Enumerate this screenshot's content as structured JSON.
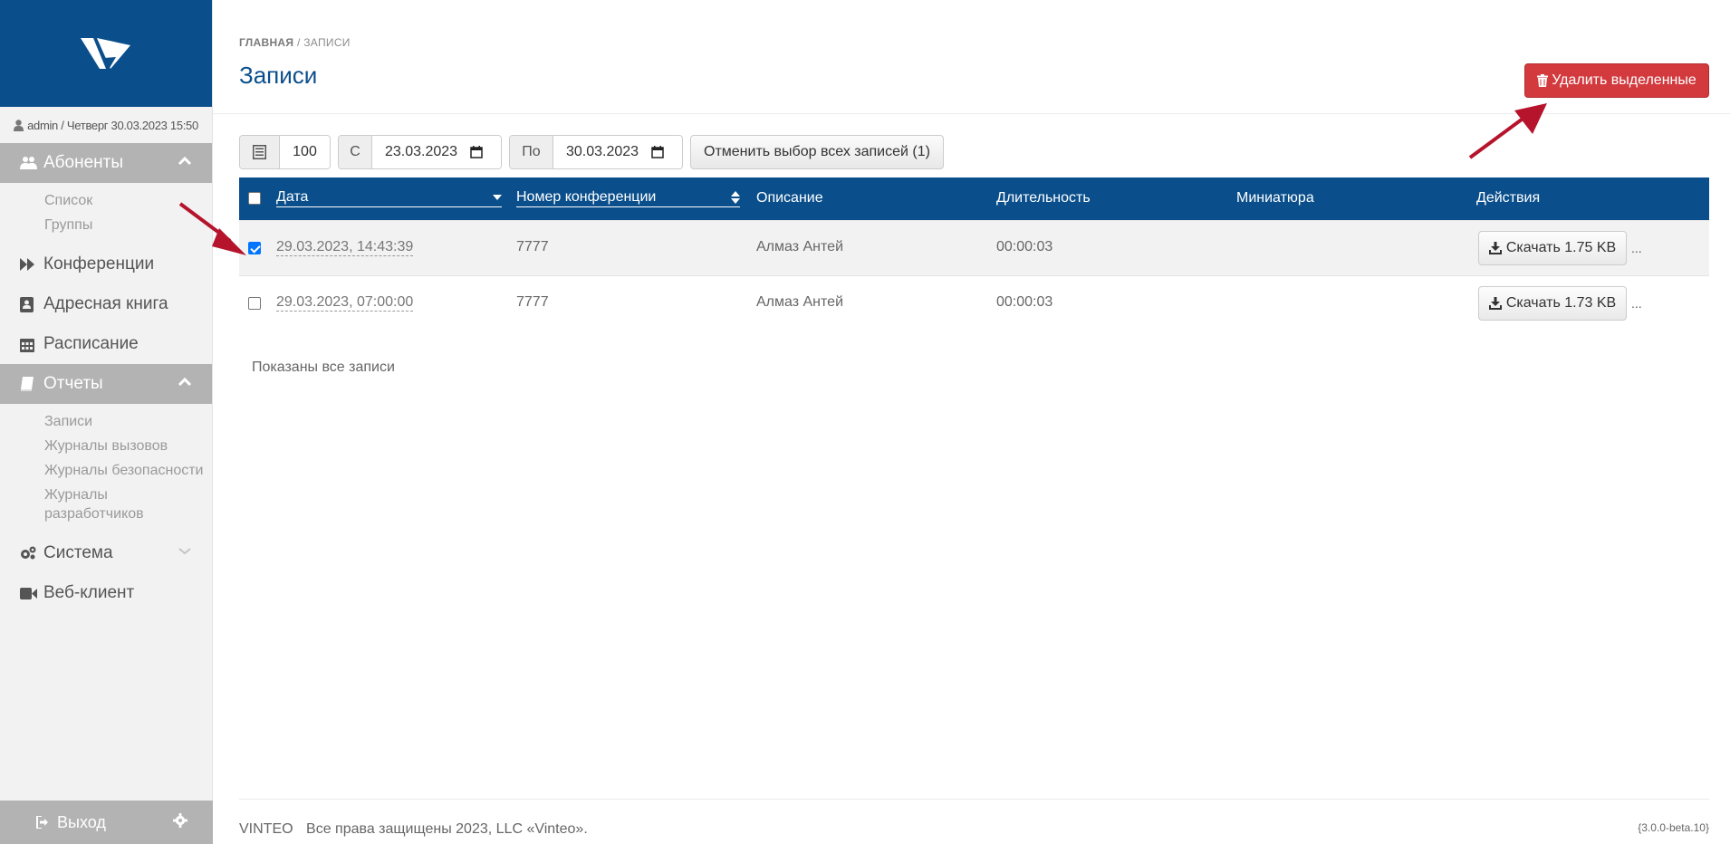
{
  "app": {
    "accent_color": "#0a4f8c",
    "danger_color": "#d23a3e"
  },
  "sidebar": {
    "logo_icon": "vinteo-logo",
    "user_info": "admin / Четверг 30.03.2023 15:50",
    "sections": [
      {
        "label": "Абоненты",
        "icon": "users-icon",
        "expanded": true,
        "items": [
          "Список",
          "Группы"
        ]
      },
      {
        "label": "Конференции",
        "icon": "fast-forward-icon"
      },
      {
        "label": "Адресная книга",
        "icon": "address-book-icon"
      },
      {
        "label": "Расписание",
        "icon": "calendar-icon"
      },
      {
        "label": "Отчеты",
        "icon": "book-icon",
        "expanded": true,
        "items": [
          "Записи",
          "Журналы вызовов",
          "Журналы безопасности",
          "Журналы разработчиков"
        ]
      },
      {
        "label": "Система",
        "icon": "cogs-icon",
        "expanded": false
      },
      {
        "label": "Веб-клиент",
        "icon": "video-camera-icon"
      }
    ],
    "logout_label": "Выход"
  },
  "header": {
    "breadcrumb_home": "ГЛАВНАЯ",
    "breadcrumb_sep": "/",
    "breadcrumb_current": "ЗАПИСИ",
    "title": "Записи",
    "delete_button": "Удалить выделенные"
  },
  "filters": {
    "page_size": "100",
    "from_label": "С",
    "from_date": "23.03.2023",
    "to_label": "По",
    "to_date": "30.03.2023",
    "unselect_button": "Отменить выбор всех записей (1)"
  },
  "table": {
    "columns": {
      "date": "Дата",
      "conference": "Номер конференции",
      "description": "Описание",
      "duration": "Длительность",
      "thumbnail": "Миниатюра",
      "actions": "Действия"
    },
    "rows": [
      {
        "checked": true,
        "date": "29.03.2023, 14:43:39",
        "conference": "7777",
        "description": "Алмаз Антей",
        "duration": "00:00:03",
        "download": "Скачать 1.75 KB",
        "more": "..."
      },
      {
        "checked": false,
        "date": "29.03.2023, 07:00:00",
        "conference": "7777",
        "description": "Алмаз Антей",
        "duration": "00:00:03",
        "download": "Скачать 1.73 KB",
        "more": "..."
      }
    ],
    "footer_note": "Показаны все записи"
  },
  "footer": {
    "brand": "VINTEO",
    "copyright": "Все права защищены 2023, LLC «Vinteo».",
    "version": "{3.0.0-beta.10}"
  }
}
